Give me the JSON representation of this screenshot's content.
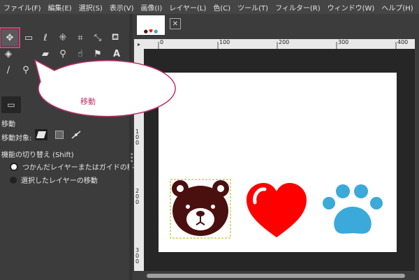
{
  "menu": [
    "ファイル(F)",
    "編集(E)",
    "選択(S)",
    "表示(V)",
    "画像(I)",
    "レイヤー(L)",
    "色(C)",
    "ツール(T)",
    "フィルター(R)",
    "ウィンドウ(W)",
    "ヘルプ(H)"
  ],
  "callout": {
    "text": "移動"
  },
  "tool_options": {
    "title": "移動",
    "target_label": "移動対象:",
    "toggle_label": "機能の切り替え (Shift)",
    "radio_pick": "つかんだレイヤーまたはガイドの移動",
    "radio_active": "選択したレイヤーの移動"
  },
  "ruler": {
    "h_ticks": [
      "0",
      "100",
      "200",
      "300",
      "400"
    ],
    "v_ticks": [
      "100",
      "200",
      "300"
    ]
  },
  "icons": [
    "move-icon",
    "rect-select-icon",
    "lasso-icon",
    "fuzzy-select-icon",
    "crop-icon",
    "unified-transform-icon",
    "warp-icon",
    "bucket-fill-icon",
    "eraser-icon",
    "clone-icon",
    "smudge-icon",
    "text-icon",
    "color-picker-icon",
    "zoom-icon"
  ],
  "colors": {
    "accent": "#d2417a",
    "bear": "#4a1010",
    "heart": "#ff0000",
    "paw": "#3ba9d9"
  }
}
